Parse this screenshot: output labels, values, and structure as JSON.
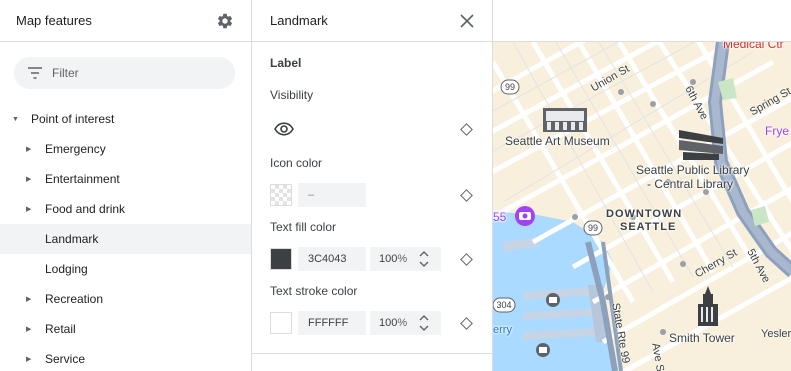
{
  "left_panel": {
    "title": "Map features",
    "filter_placeholder": "Filter",
    "tree": [
      {
        "label": "Point of interest",
        "level": 0,
        "expandable": true,
        "selected": false
      },
      {
        "label": "Emergency",
        "level": 1,
        "expandable": true,
        "selected": false
      },
      {
        "label": "Entertainment",
        "level": 1,
        "expandable": true,
        "selected": false
      },
      {
        "label": "Food and drink",
        "level": 1,
        "expandable": true,
        "selected": false
      },
      {
        "label": "Landmark",
        "level": 1,
        "expandable": false,
        "selected": true
      },
      {
        "label": "Lodging",
        "level": 1,
        "expandable": false,
        "selected": false
      },
      {
        "label": "Recreation",
        "level": 1,
        "expandable": true,
        "selected": false
      },
      {
        "label": "Retail",
        "level": 1,
        "expandable": true,
        "selected": false
      },
      {
        "label": "Service",
        "level": 1,
        "expandable": true,
        "selected": false
      }
    ]
  },
  "detail_panel": {
    "title": "Landmark",
    "section": "Label",
    "visibility_label": "Visibility",
    "icon_color_label": "Icon color",
    "icon_color_value": "–",
    "text_fill_label": "Text fill color",
    "text_fill_hex": "3C4043",
    "text_fill_color": "#3c4043",
    "text_fill_opacity": "100",
    "text_stroke_label": "Text stroke color",
    "text_stroke_hex": "FFFFFF",
    "text_stroke_color": "#ffffff",
    "text_stroke_opacity": "100",
    "percent_unit": "%"
  },
  "map": {
    "pois": [
      "Seattle Art Museum",
      "Seattle Public Library",
      "- Central Library",
      "Smith Tower"
    ],
    "areas": [
      "DOWNTOWN",
      "SEATTLE"
    ],
    "streets": [
      "Union St",
      "6th Ave",
      "Spring St",
      "Cherry St",
      "5th Ave",
      "State Rte 99",
      "Yesler",
      "Ave S"
    ],
    "partial_labels": [
      "Medical Ctr",
      "Frye",
      "55",
      "erry"
    ],
    "route_shields": [
      "99",
      "99",
      "304"
    ]
  }
}
